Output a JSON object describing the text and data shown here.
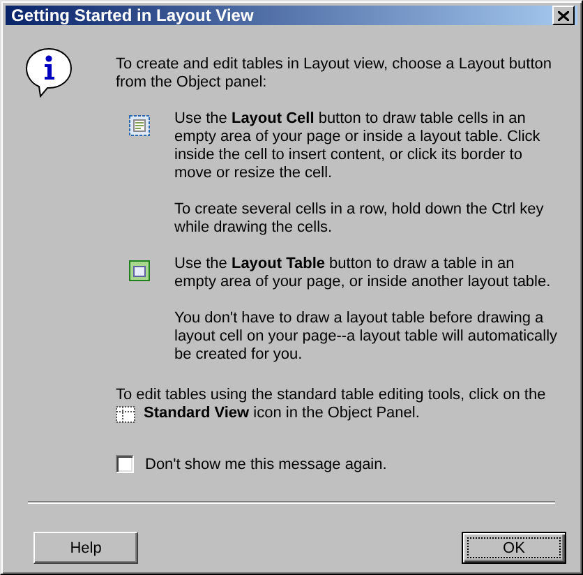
{
  "window": {
    "title": "Getting Started in Layout View"
  },
  "intro": "To create and edit tables in Layout view, choose a Layout button from the Object panel:",
  "tools": [
    {
      "kind": "layout-cell",
      "paragraphs": [
        "Use the **Layout Cell** button to draw table cells in an empty area of your page or inside a layout table. Click inside the cell to insert content, or click its border to move or resize the cell.",
        "To create several cells in a row, hold down the Ctrl key while drawing the cells."
      ]
    },
    {
      "kind": "layout-table",
      "paragraphs": [
        "Use the **Layout Table** button to draw a table in an empty area of your page, or inside another layout table.",
        "You don't have to draw a layout table before drawing a layout cell on your page--a layout table will automatically be created for you."
      ]
    }
  ],
  "standard_view": {
    "line": "To edit tables using the standard table editing tools, click on the",
    "icon_text": "**Standard View** icon in the Object Panel."
  },
  "checkbox": {
    "label": "Don't show me this message again.",
    "checked": false
  },
  "buttons": [
    {
      "label": "Help",
      "default": false
    },
    {
      "label": "OK",
      "default": true
    }
  ]
}
